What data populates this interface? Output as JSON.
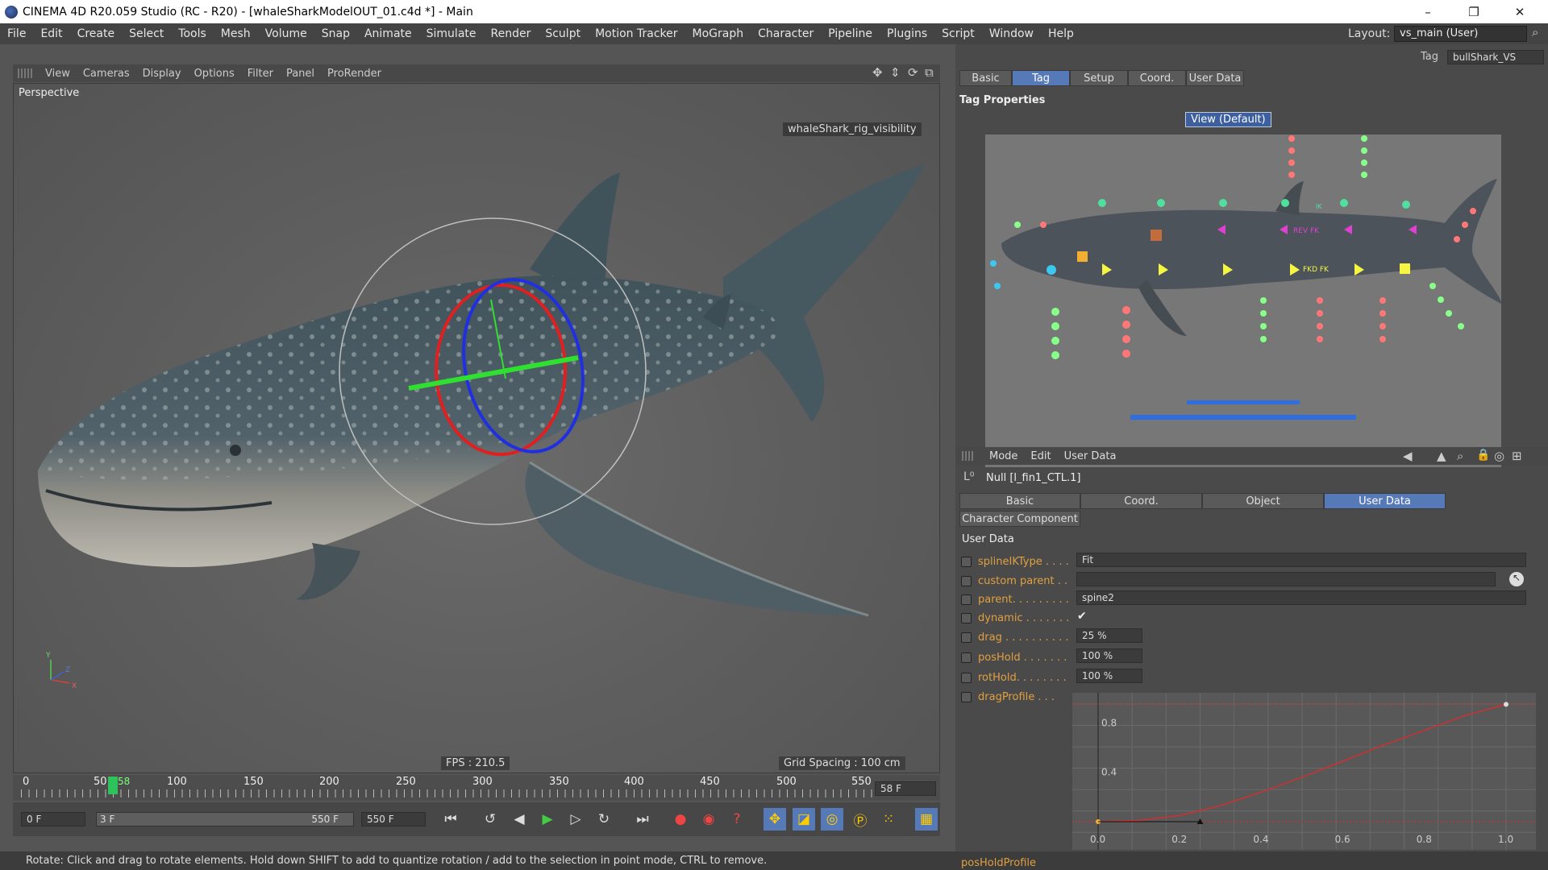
{
  "window": {
    "title": "CINEMA 4D R20.059 Studio (RC - R20) - [whaleSharkModelOUT_01.c4d *] - Main",
    "minimize": "–",
    "maximize": "❐",
    "close": "✕"
  },
  "menubar": {
    "items": [
      "File",
      "Edit",
      "Create",
      "Select",
      "Tools",
      "Mesh",
      "Volume",
      "Snap",
      "Animate",
      "Simulate",
      "Render",
      "Sculpt",
      "Motion Tracker",
      "MoGraph",
      "Character",
      "Pipeline",
      "Plugins",
      "Script",
      "Window",
      "Help"
    ],
    "layout_label": "Layout:",
    "layout_value": "vs_main (User)"
  },
  "viewport": {
    "menu": [
      "View",
      "Cameras",
      "Display",
      "Options",
      "Filter",
      "Panel",
      "ProRender"
    ],
    "camera_label": "Perspective",
    "object_tag": "whaleShark_rig_visibility",
    "fps": "FPS : 210.5",
    "grid_spacing": "Grid Spacing : 100 cm",
    "axis_labels": {
      "x": "X",
      "y": "Y",
      "z": "Z"
    }
  },
  "timeline": {
    "ticks": [
      "0",
      "50",
      "100",
      "150",
      "200",
      "250",
      "300",
      "350",
      "400",
      "450",
      "500",
      "550"
    ],
    "current_frame_marker": "58",
    "current_frame_field": "58 F"
  },
  "transport": {
    "start_field": "0 F",
    "range_start": "3 F",
    "range_end": "550 F",
    "end_field": "550 F"
  },
  "status": {
    "text": "Rotate: Click and drag to rotate elements. Hold down SHIFT to add to quantize rotation / add to the selection in point mode, CTRL to remove."
  },
  "tag_panel": {
    "tag_label": "Tag",
    "tag_value": "bullShark_VS",
    "tabs": [
      "Basic",
      "Tag",
      "Setup",
      "Coord.",
      "User Data"
    ],
    "active_tab": "Tag",
    "section_title": "Tag Properties",
    "view_button": "View (Default)",
    "picker_labels": {
      "ik": "IK",
      "rev_fk": "REV FK",
      "fkd_fk": "FKD FK"
    }
  },
  "attr_panel": {
    "menu": [
      "Mode",
      "Edit",
      "User Data"
    ],
    "object_name": "Null [l_fin1_CTL.1]",
    "tabs": [
      "Basic",
      "Coord.",
      "Object",
      "User Data"
    ],
    "active_tab": "User Data",
    "subtab": "Character Component",
    "section_title": "User Data",
    "fields": [
      {
        "label": "splineIKType . . . .",
        "value": "Fit"
      },
      {
        "label": "custom parent . .",
        "value": ""
      },
      {
        "label": "parent. . . . . . . . .",
        "value": "spine2"
      },
      {
        "label": "dynamic . . . . . . .",
        "value": "✔"
      },
      {
        "label": "drag . . . . . . . . . .",
        "value": "25 %"
      },
      {
        "label": "posHold . . . . . . .",
        "value": "100 %"
      },
      {
        "label": "rotHold. . . . . . . .",
        "value": "100 %"
      },
      {
        "label": "dragProfile . . .",
        "value": ""
      }
    ],
    "next_field": "posHoldProfile",
    "graph": {
      "y_ticks": [
        "0.8",
        "0.4"
      ],
      "x_ticks": [
        "0.0",
        "0.2",
        "0.4",
        "0.6",
        "0.8",
        "1.0"
      ]
    }
  },
  "chart_data": {
    "type": "line",
    "title": "",
    "xlabel": "",
    "ylabel": "",
    "xlim": [
      0,
      1
    ],
    "ylim": [
      0,
      1
    ],
    "x": [
      0.0,
      0.1,
      0.2,
      0.3,
      0.4,
      0.5,
      0.6,
      0.7,
      0.8,
      0.9,
      1.0
    ],
    "y": [
      0.0,
      0.01,
      0.05,
      0.13,
      0.24,
      0.36,
      0.49,
      0.62,
      0.74,
      0.86,
      0.95
    ],
    "grid": true
  }
}
